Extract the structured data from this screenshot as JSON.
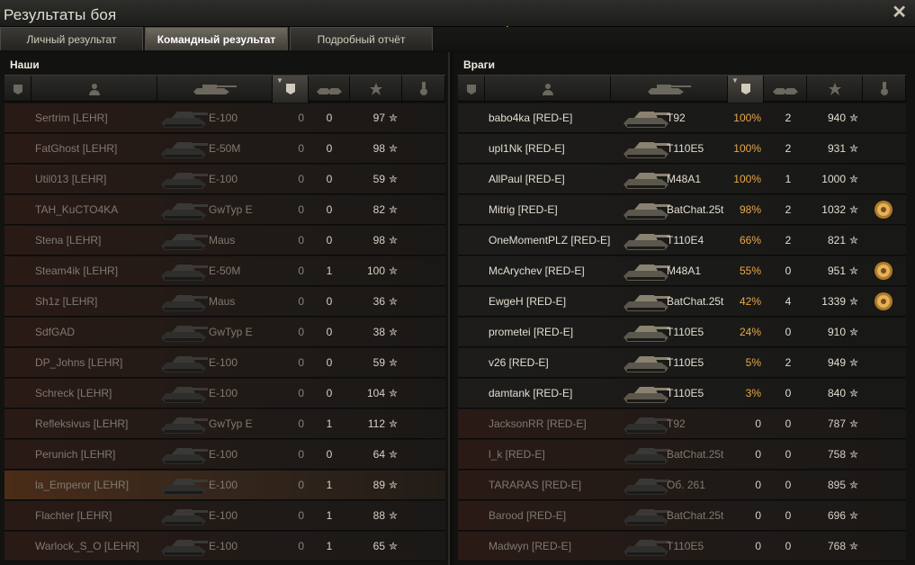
{
  "window": {
    "title": "Результаты боя",
    "close_glyph": "✕"
  },
  "tabs": [
    {
      "label": "Личный результат",
      "active": false
    },
    {
      "label": "Командный результат",
      "active": true
    },
    {
      "label": "Подробный отчёт",
      "active": false
    }
  ],
  "columns": {
    "icons": [
      "squad-icon",
      "player-icon",
      "tank-icon",
      "damage-icon",
      "kills-icon",
      "xp-star-icon",
      "medal-icon"
    ],
    "sorted_column": "damage"
  },
  "allies": {
    "label": "Наши",
    "players": [
      {
        "name": "Sertrim [LEHR]",
        "tank": "E-100",
        "damage": "0",
        "kills": "0",
        "xp": "97"
      },
      {
        "name": "FatGhost [LEHR]",
        "tank": "E-50M",
        "damage": "0",
        "kills": "0",
        "xp": "98"
      },
      {
        "name": "Util013 [LEHR]",
        "tank": "E-100",
        "damage": "0",
        "kills": "0",
        "xp": "59"
      },
      {
        "name": "TAH_KuCTO4KA",
        "tank": "GwTyp E",
        "damage": "0",
        "kills": "0",
        "xp": "82"
      },
      {
        "name": "Stena [LEHR]",
        "tank": "Maus",
        "damage": "0",
        "kills": "0",
        "xp": "98"
      },
      {
        "name": "Steam4ik [LEHR]",
        "tank": "E-50M",
        "damage": "0",
        "kills": "1",
        "xp": "100"
      },
      {
        "name": "Sh1z [LEHR]",
        "tank": "Maus",
        "damage": "0",
        "kills": "0",
        "xp": "36"
      },
      {
        "name": "SdfGAD",
        "tank": "GwTyp E",
        "damage": "0",
        "kills": "0",
        "xp": "38"
      },
      {
        "name": "DP_Johns [LEHR]",
        "tank": "E-100",
        "damage": "0",
        "kills": "0",
        "xp": "59"
      },
      {
        "name": "Schreck [LEHR]",
        "tank": "E-100",
        "damage": "0",
        "kills": "0",
        "xp": "104"
      },
      {
        "name": "Refleksivus [LEHR]",
        "tank": "GwTyp E",
        "damage": "0",
        "kills": "1",
        "xp": "112"
      },
      {
        "name": "Perunich [LEHR]",
        "tank": "E-100",
        "damage": "0",
        "kills": "0",
        "xp": "64"
      },
      {
        "name": "la_Emperor [LEHR]",
        "tank": "E-100",
        "damage": "0",
        "kills": "1",
        "xp": "89",
        "highlight": true
      },
      {
        "name": "Flachter [LEHR]",
        "tank": "E-100",
        "damage": "0",
        "kills": "1",
        "xp": "88"
      },
      {
        "name": "Warlock_S_O [LEHR]",
        "tank": "E-100",
        "damage": "0",
        "kills": "1",
        "xp": "65"
      }
    ]
  },
  "enemies": {
    "label": "Враги",
    "players": [
      {
        "name": "babo4ka [RED-E]",
        "tank": "T92",
        "damage": "100%",
        "kills": "2",
        "xp": "940",
        "alive": true,
        "medal": false
      },
      {
        "name": "upl1Nk [RED-E]",
        "tank": "T110E5",
        "damage": "100%",
        "kills": "2",
        "xp": "931",
        "alive": true,
        "medal": false
      },
      {
        "name": "AllPaul [RED-E]",
        "tank": "M48A1",
        "damage": "100%",
        "kills": "1",
        "xp": "1000",
        "alive": true,
        "medal": false
      },
      {
        "name": "Mitrig [RED-E]",
        "tank": "BatChat.25t",
        "damage": "98%",
        "kills": "2",
        "xp": "1032",
        "alive": true,
        "medal": true
      },
      {
        "name": "OneMomentPLZ [RED-E]",
        "tank": "T110E4",
        "damage": "66%",
        "kills": "2",
        "xp": "821",
        "alive": true,
        "medal": false
      },
      {
        "name": "McArychev [RED-E]",
        "tank": "M48A1",
        "damage": "55%",
        "kills": "0",
        "xp": "951",
        "alive": true,
        "medal": true
      },
      {
        "name": "EwgeH [RED-E]",
        "tank": "BatChat.25t",
        "damage": "42%",
        "kills": "4",
        "xp": "1339",
        "alive": true,
        "medal": true
      },
      {
        "name": "prometei [RED-E]",
        "tank": "T110E5",
        "damage": "24%",
        "kills": "0",
        "xp": "910",
        "alive": true,
        "medal": false
      },
      {
        "name": "v26 [RED-E]",
        "tank": "T110E5",
        "damage": "5%",
        "kills": "2",
        "xp": "949",
        "alive": true,
        "medal": false
      },
      {
        "name": "damtank [RED-E]",
        "tank": "T110E5",
        "damage": "3%",
        "kills": "0",
        "xp": "840",
        "alive": true,
        "medal": false
      },
      {
        "name": "JacksonRR [RED-E]",
        "tank": "T92",
        "damage": "0",
        "kills": "0",
        "xp": "787",
        "alive": false,
        "medal": false
      },
      {
        "name": "l_k [RED-E]",
        "tank": "BatChat.25t",
        "damage": "0",
        "kills": "0",
        "xp": "758",
        "alive": false,
        "medal": false
      },
      {
        "name": "TARARAS [RED-E]",
        "tank": "Об. 261",
        "damage": "0",
        "kills": "0",
        "xp": "895",
        "alive": false,
        "medal": false
      },
      {
        "name": "Barood [RED-E]",
        "tank": "BatChat.25t",
        "damage": "0",
        "kills": "0",
        "xp": "696",
        "alive": false,
        "medal": false
      },
      {
        "name": "Madwyn [RED-E]",
        "tank": "T110E5",
        "damage": "0",
        "kills": "0",
        "xp": "768",
        "alive": false,
        "medal": false
      }
    ]
  },
  "colors": {
    "accent_orange": "#e9a84a",
    "ally_row": "#2a1a16",
    "enemy_row": "#1d1c1a"
  },
  "star_glyph": "✮"
}
